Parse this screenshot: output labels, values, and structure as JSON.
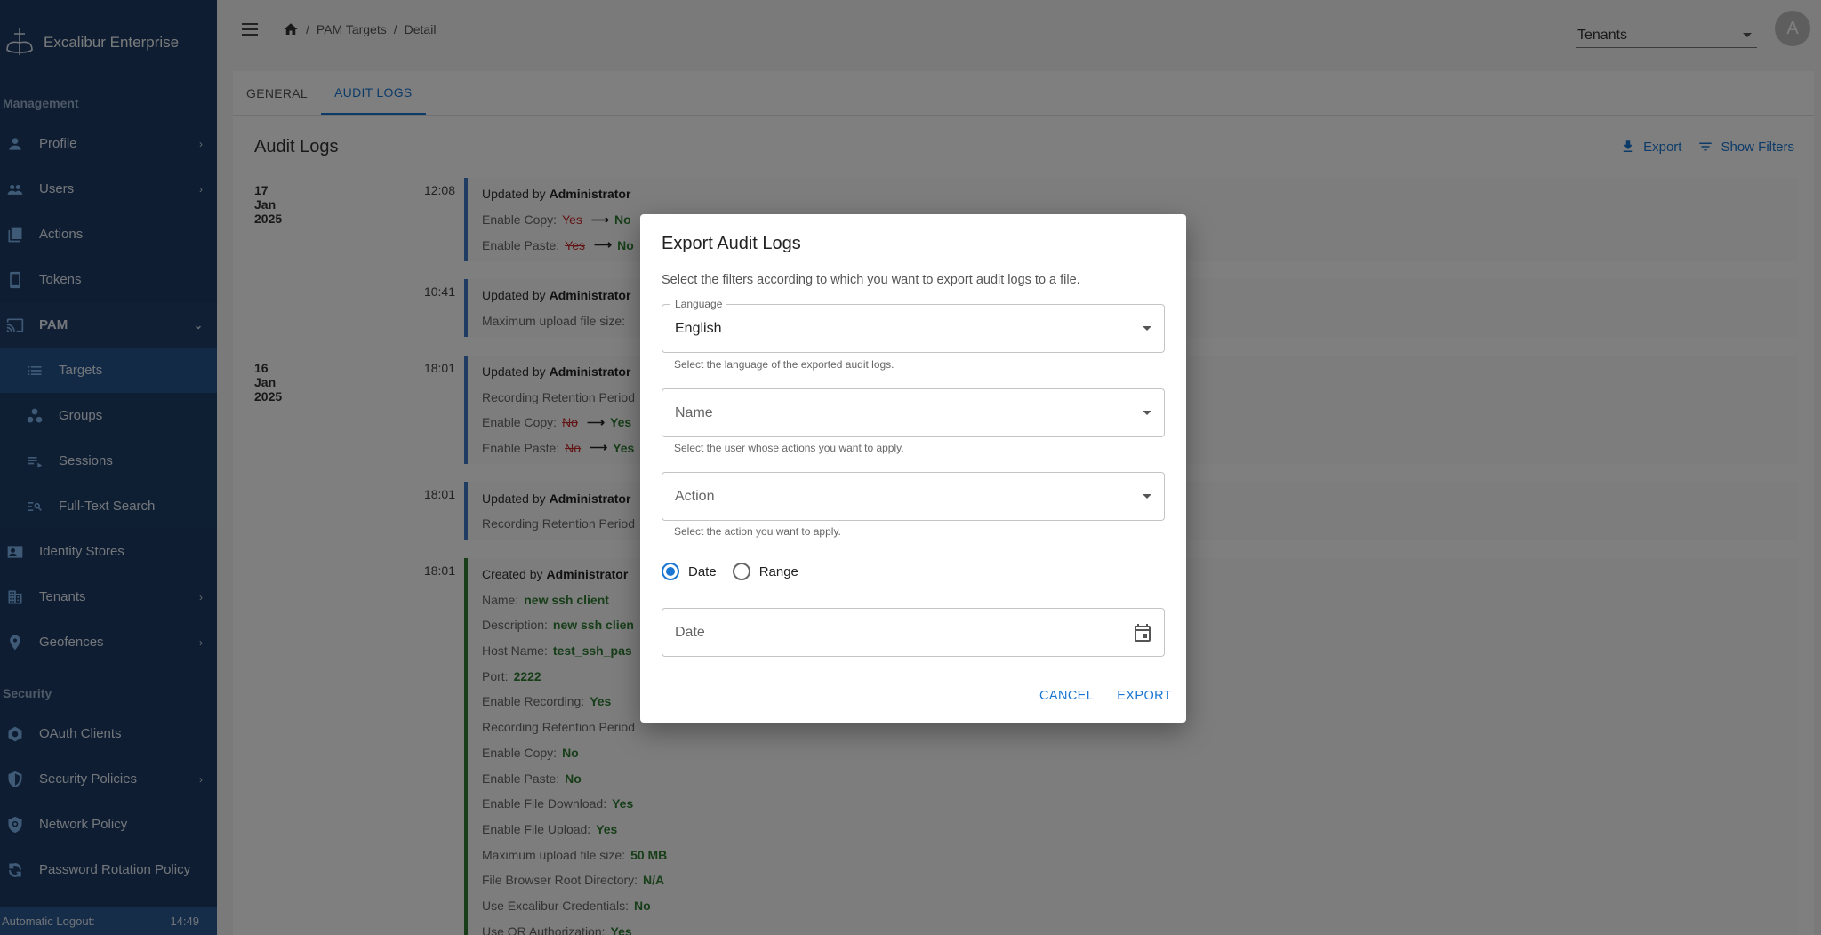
{
  "brand": {
    "name": "Excalibur Enterprise",
    "logo_icon": "excalibur-logo-icon"
  },
  "sidebar": {
    "management_title": "Management",
    "items": [
      {
        "label": "Profile",
        "icon": "person-icon",
        "chevron": true
      },
      {
        "label": "Users",
        "icon": "users-icon",
        "chevron": true
      },
      {
        "label": "Actions",
        "icon": "actions-icon"
      },
      {
        "label": "Tokens",
        "icon": "phone-icon"
      },
      {
        "label": "PAM",
        "icon": "cast-icon",
        "open": true
      }
    ],
    "pam_sub": [
      {
        "label": "Targets",
        "icon": "list-icon",
        "active": true
      },
      {
        "label": "Groups",
        "icon": "groups-icon"
      },
      {
        "label": "Sessions",
        "icon": "playlist-icon"
      },
      {
        "label": "Full-Text Search",
        "icon": "search-list-icon"
      }
    ],
    "items_after": [
      {
        "label": "Identity Stores",
        "icon": "contact-icon"
      },
      {
        "label": "Tenants",
        "icon": "building-icon",
        "chevron": true
      },
      {
        "label": "Geofences",
        "icon": "location-icon",
        "chevron": true
      }
    ],
    "security_title": "Security",
    "security_items": [
      {
        "label": "OAuth Clients",
        "icon": "hexagon-icon"
      },
      {
        "label": "Security Policies",
        "icon": "shield-icon",
        "chevron": true
      },
      {
        "label": "Network Policy",
        "icon": "network-shield-icon"
      },
      {
        "label": "Password Rotation Policy",
        "icon": "rotation-icon"
      }
    ],
    "footer": {
      "label": "Automatic Logout:",
      "time": "14:49"
    }
  },
  "topbar": {
    "breadcrumbs": [
      "PAM Targets",
      "Detail"
    ],
    "separator": "/",
    "tenants_placeholder": "Tenants",
    "avatar_letter": "A"
  },
  "tabs": [
    {
      "label": "GENERAL",
      "active": false
    },
    {
      "label": "AUDIT LOGS",
      "active": true
    }
  ],
  "audit": {
    "title": "Audit Logs",
    "export_label": "Export",
    "filters_label": "Show Filters",
    "entries": [
      {
        "date": "17 Jan 2025",
        "time": "12:08",
        "kind": "update",
        "by_prefix": "Updated by",
        "by": "Administrator",
        "lines": [
          {
            "label": "Enable Copy:",
            "old": "Yes",
            "new": "No"
          },
          {
            "label": "Enable Paste:",
            "old": "Yes",
            "new": "No"
          }
        ]
      },
      {
        "date": "",
        "time": "10:41",
        "kind": "update",
        "by_prefix": "Updated by",
        "by": "Administrator",
        "lines": [
          {
            "label": "Maximum upload file size:"
          }
        ]
      },
      {
        "date": "16 Jan 2025",
        "time": "18:01",
        "kind": "update",
        "by_prefix": "Updated by",
        "by": "Administrator",
        "lines": [
          {
            "label": "Recording Retention Period"
          },
          {
            "label": "Enable Copy:",
            "old": "No",
            "new": "Yes"
          },
          {
            "label": "Enable Paste:",
            "old": "No",
            "new": "Yes"
          }
        ]
      },
      {
        "date": "",
        "time": "18:01",
        "kind": "update",
        "by_prefix": "Updated by",
        "by": "Administrator",
        "lines": [
          {
            "label": "Recording Retention Period"
          }
        ]
      },
      {
        "date": "",
        "time": "18:01",
        "kind": "create",
        "by_prefix": "Created by",
        "by": "Administrator",
        "lines": [
          {
            "label": "Name:",
            "new": "new ssh client"
          },
          {
            "label": "Description:",
            "new": "new ssh clien"
          },
          {
            "label": "Host Name:",
            "new": "test_ssh_pas"
          },
          {
            "label": "Port:",
            "new": "2222"
          },
          {
            "label": "Enable Recording:",
            "new": "Yes"
          },
          {
            "label": "Recording Retention Period"
          },
          {
            "label": "Enable Copy:",
            "new": "No"
          },
          {
            "label": "Enable Paste:",
            "new": "No"
          },
          {
            "label": "Enable File Download:",
            "new": "Yes"
          },
          {
            "label": "Enable File Upload:",
            "new": "Yes"
          },
          {
            "label": "Maximum upload file size:",
            "new": "50 MB"
          },
          {
            "label": "File Browser Root Directory:",
            "new": "N/A"
          },
          {
            "label": "Use Excalibur Credentials:",
            "new": "No"
          },
          {
            "label": "Use QR Authorization:",
            "new": "Yes"
          }
        ]
      }
    ]
  },
  "dialog": {
    "title": "Export Audit Logs",
    "description": "Select the filters according to which you want to export audit logs to a file.",
    "language": {
      "label": "Language",
      "value": "English",
      "helper": "Select the language of the exported audit logs."
    },
    "name": {
      "placeholder": "Name",
      "helper": "Select the user whose actions you want to apply."
    },
    "action": {
      "placeholder": "Action",
      "helper": "Select the action you want to apply."
    },
    "mode": {
      "options": [
        "Date",
        "Range"
      ],
      "selected": "Date"
    },
    "date": {
      "placeholder": "Date"
    },
    "cancel_label": "CANCEL",
    "export_label": "EXPORT"
  }
}
